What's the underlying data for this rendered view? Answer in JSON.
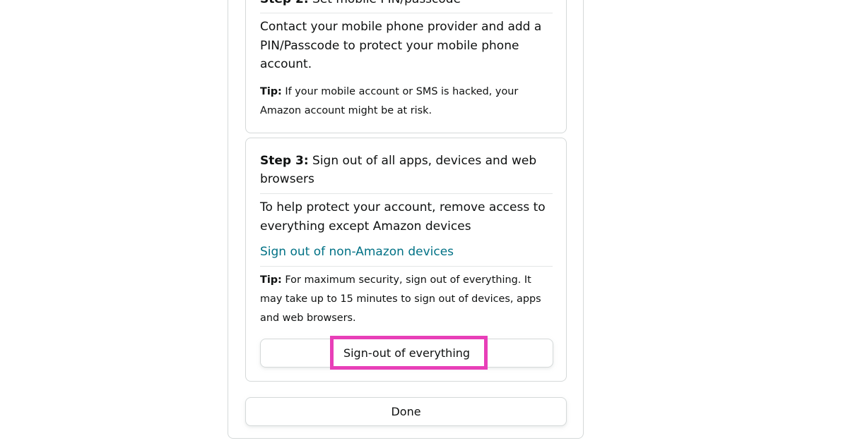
{
  "step2": {
    "heading_bold": "Step 2:",
    "heading_rest": " Set mobile PIN/passcode",
    "body": "Contact your mobile phone provider and add a PIN/Passcode to protect your mobile phone account.",
    "tip_bold": "Tip:",
    "tip_rest": " If your mobile account or SMS is hacked, your Amazon account might be at risk."
  },
  "step3": {
    "heading_bold": "Step 3:",
    "heading_rest": " Sign out of all apps, devices and web browsers",
    "body": "To help protect your account, remove access to everything except Amazon devices",
    "link": "Sign out of non-Amazon devices",
    "tip_bold": "Tip:",
    "tip_rest": " For maximum security, sign out of everything. It may take up to 15 minutes to sign out of devices, apps and web browsers.",
    "signout_button": "Sign-out of everything"
  },
  "done_button": "Done",
  "colors": {
    "link": "#007185",
    "highlight": "#e83fb8",
    "border": "#d5d9d9"
  }
}
